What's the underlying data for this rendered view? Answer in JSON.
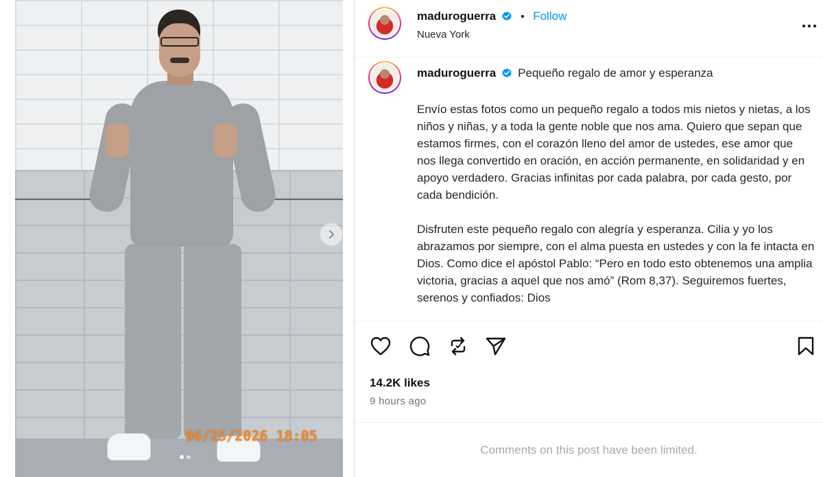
{
  "media": {
    "photo_timestamp": "06/25/2026  18:05",
    "next_button_icon": "chevron-right-icon",
    "carousel_count": 2,
    "carousel_active_index": 0
  },
  "post_header": {
    "username": "maduroguerra",
    "verified": true,
    "separator": "•",
    "follow_label": "Follow",
    "location": "Nueva York",
    "more_icon": "more-options-icon"
  },
  "caption": {
    "username": "maduroguerra",
    "title": "Pequeño regalo de amor y esperanza",
    "paragraphs": [
      "Envío estas fotos como un pequeño regalo a todos mis nietos y nietas, a los niños y niñas, y a toda la gente noble que nos ama. Quiero que sepan que estamos firmes, con el corazón lleno del amor de ustedes, ese amor que nos llega convertido en oración, en acción permanente, en solidaridad y en apoyo verdadero. Gracias infinitas por cada palabra, por cada gesto, por cada bendición.",
      "Disfruten este pequeño regalo con alegría y esperanza. Cilia y yo los abrazamos por siempre, con el alma puesta en ustedes y con la fe intacta en Dios. Como dice el apóstol Pablo: “Pero en todo esto obtenemos una amplia victoria, gracias a aquel que nos amó” (Rom 8,37). Seguiremos fuertes, serenos y confiados: Dios"
    ]
  },
  "actions": {
    "like_icon": "heart-icon",
    "comment_icon": "comment-icon",
    "repost_icon": "repost-icon",
    "share_icon": "send-icon",
    "save_icon": "bookmark-icon",
    "likes": "14.2K likes",
    "time_ago": "9 hours ago"
  },
  "comments": {
    "limited_text": "Comments on this post have been limited."
  },
  "colors": {
    "accent_blue": "#0095f6",
    "verified_blue": "#0095f6",
    "timestamp_orange": "#f08a2a",
    "muted_text": "#737373"
  }
}
